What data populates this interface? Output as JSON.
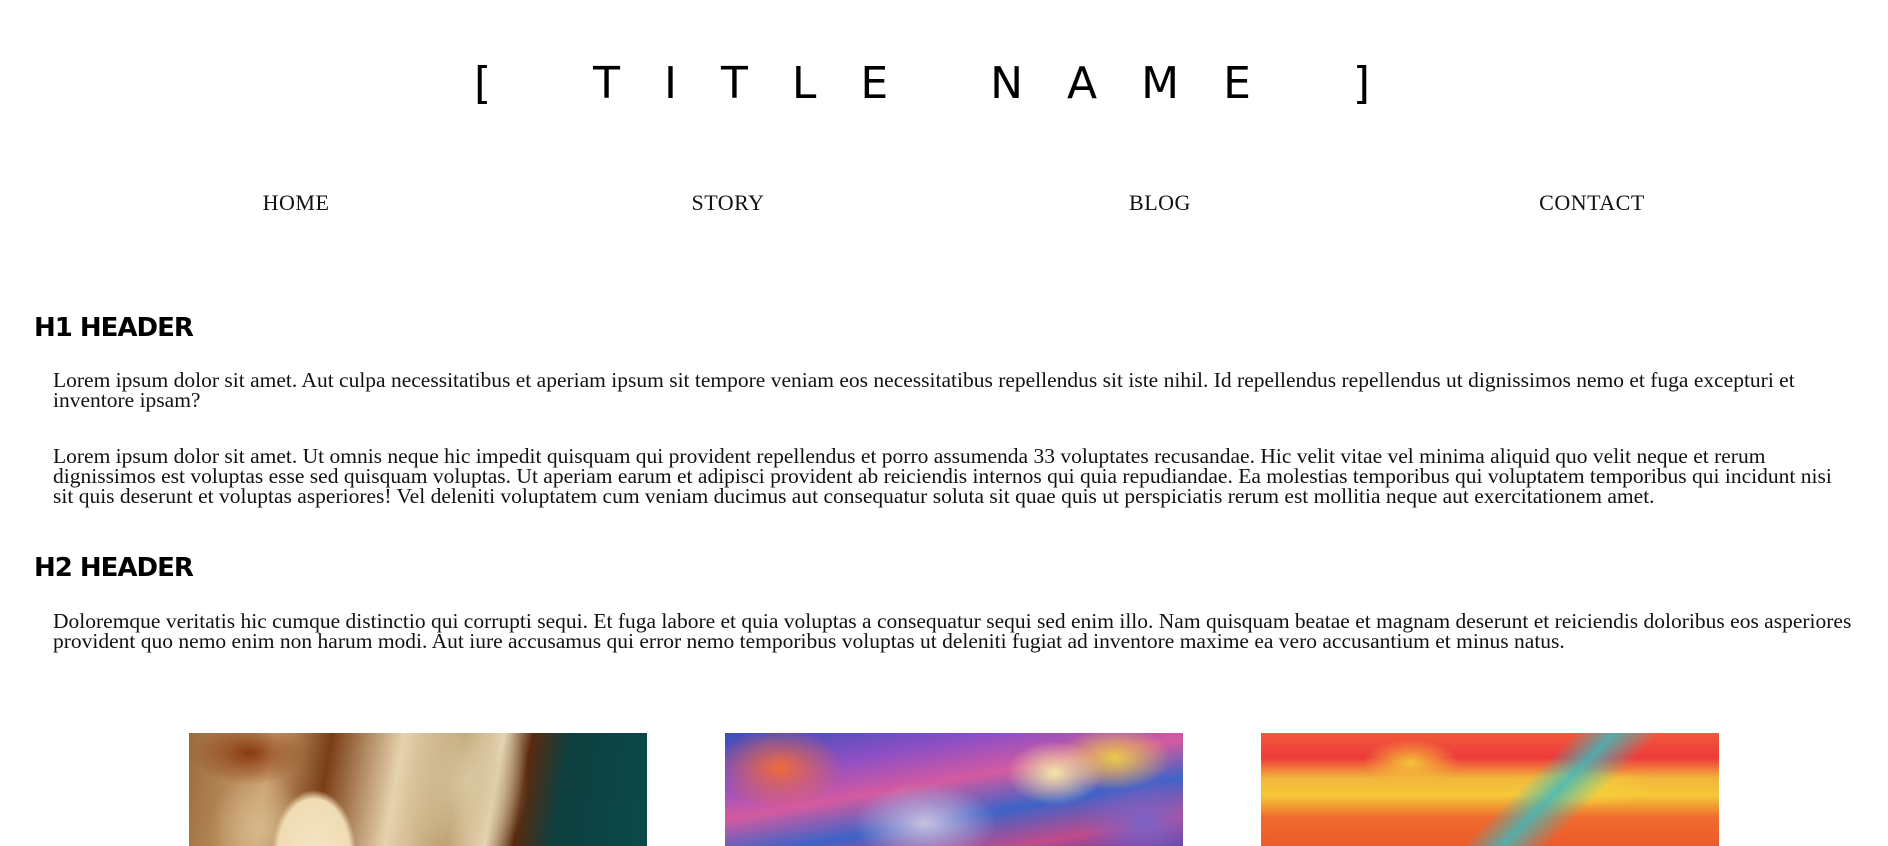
{
  "header": {
    "title": "[ TITLE NAME ]"
  },
  "nav": {
    "items": [
      "HOME",
      "STORY",
      "BLOG",
      "CONTACT"
    ]
  },
  "content": {
    "h1": "H1 HEADER",
    "p1": "Lorem ipsum dolor sit amet. Aut culpa necessitatibus et aperiam ipsum sit tempore veniam eos necessitatibus repellendus sit iste nihil. Id repellendus repellendus ut dignissimos nemo et fuga excepturi et inventore ipsam?",
    "p2": "Lorem ipsum dolor sit amet. Ut omnis neque hic impedit quisquam qui provident repellendus et porro assumenda 33 voluptates recusandae. Hic velit vitae vel minima aliquid quo velit neque et rerum dignissimos est voluptas esse sed quisquam voluptas. Ut aperiam earum et adipisci provident ab reiciendis internos qui quia repudiandae. Ea molestias temporibus qui voluptatem temporibus qui incidunt nisi sit quis deserunt et voluptas asperiores! Vel deleniti voluptatem cum veniam ducimus aut consequatur soluta sit quae quis ut perspiciatis rerum est mollitia neque aut exercitationem amet.",
    "h2": "H2 HEADER",
    "p3": "Doloremque veritatis hic cumque distinctio qui corrupti sequi. Et fuga labore et quia voluptas a consequatur sequi sed enim illo. Nam quisquam beatae et magnam deserunt et reiciendis doloribus eos asperiores provident quo nemo enim non harum modi. Aut iure accusamus qui error nemo temporibus voluptas ut deleniti fugiat ad inventore maxime ea vero accusantium et minus natus."
  },
  "gallery": {
    "images": [
      "abstract-brown-teal-painting",
      "abstract-purple-nebula-painting",
      "abstract-orange-red-painting"
    ]
  }
}
